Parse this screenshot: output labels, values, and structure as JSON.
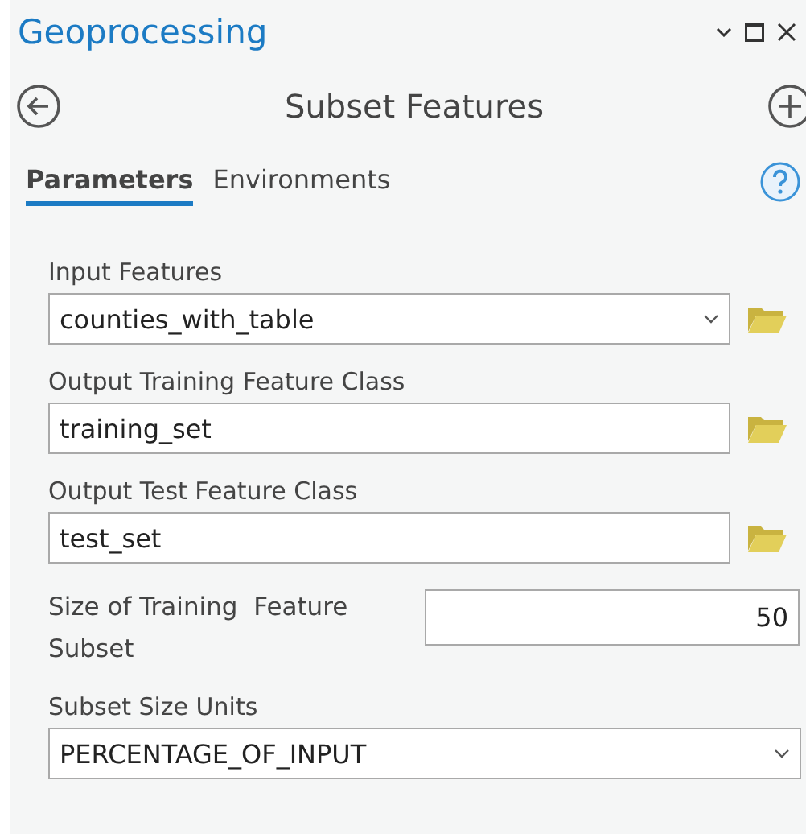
{
  "window": {
    "title": "Geoprocessing"
  },
  "tool": {
    "title": "Subset Features"
  },
  "tabs": [
    {
      "label": "Parameters",
      "selected": true
    },
    {
      "label": "Environments",
      "selected": false
    }
  ],
  "parameters": [
    {
      "kind": "dropdown",
      "label": "Input Features",
      "value": "counties_with_table",
      "browse": true
    },
    {
      "kind": "text",
      "label": "Output Training Feature Class",
      "value": "training_set",
      "browse": true
    },
    {
      "kind": "text",
      "label": "Output Test Feature Class",
      "value": "test_set",
      "browse": true
    },
    {
      "kind": "number",
      "label": "Size of Training  Feature Subset",
      "value": "50",
      "browse": false
    },
    {
      "kind": "dropdown",
      "label": "Subset Size Units",
      "value": "PERCENTAGE_OF_INPUT",
      "browse": false
    }
  ]
}
